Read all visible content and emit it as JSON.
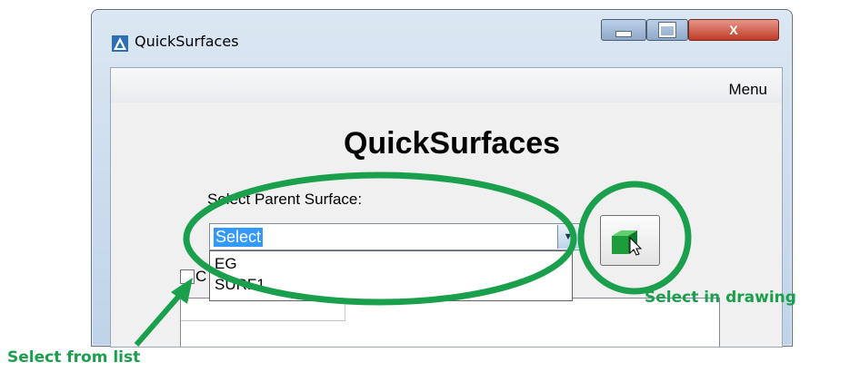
{
  "window": {
    "title": "QuickSurfaces",
    "controls": {
      "close_label": "X"
    }
  },
  "menubar": {
    "menu_label": "Menu"
  },
  "app": {
    "heading": "QuickSurfaces",
    "parent_surface_label": "Select Parent Surface:",
    "combo_value": "Select",
    "dropdown_options": [
      "EG",
      "SURF1"
    ],
    "checkbox_label_partial": "C"
  },
  "annotations": {
    "select_in_drawing": "Select in drawing",
    "select_from_list": "Select from list",
    "color": "#1aa04d"
  },
  "colors": {
    "selection_highlight": "#3399ff",
    "pick_cube": "#1e9c3c",
    "close_button": "#c03b28"
  },
  "icons": {
    "app": "autodesk-civil-icon",
    "pick": "green-cube-cursor-icon"
  }
}
